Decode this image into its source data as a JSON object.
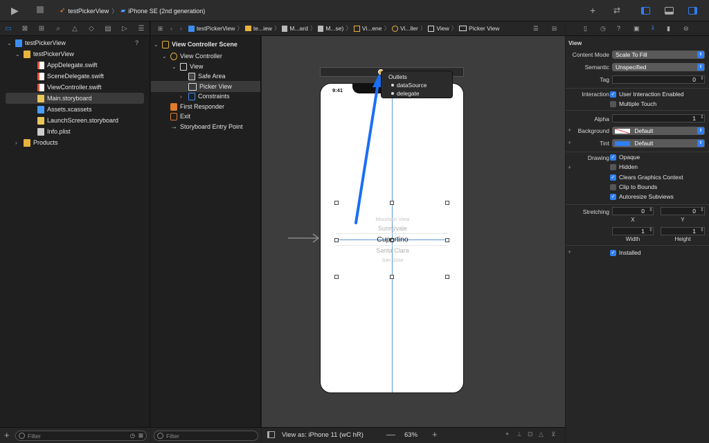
{
  "toolbar": {
    "project_name": "testPickerView",
    "device": "iPhone SE (2nd generation)"
  },
  "navigator": {
    "items": [
      {
        "label": "testPickerView",
        "icon": "project-icon",
        "level": 0,
        "badge": "?"
      },
      {
        "label": "testPickerView",
        "icon": "folder-icon",
        "level": 1
      },
      {
        "label": "AppDelegate.swift",
        "icon": "swift-file-icon",
        "level": 2
      },
      {
        "label": "SceneDelegate.swift",
        "icon": "swift-file-icon",
        "level": 2
      },
      {
        "label": "ViewController.swift",
        "icon": "swift-file-icon",
        "level": 2
      },
      {
        "label": "Main.storyboard",
        "icon": "storyboard-icon",
        "level": 2
      },
      {
        "label": "Assets.xcassets",
        "icon": "assets-icon",
        "level": 2
      },
      {
        "label": "LaunchScreen.storyboard",
        "icon": "storyboard-icon",
        "level": 2
      },
      {
        "label": "Info.plist",
        "icon": "plist-icon",
        "level": 2
      },
      {
        "label": "Products",
        "icon": "folder-icon",
        "level": 1
      }
    ],
    "filter_placeholder": "Filter"
  },
  "jump_bar": {
    "items": [
      "testPickerView",
      "te...iew",
      "M...ard",
      "M...se)",
      "Vi...ene",
      "Vi...ller",
      "View",
      "Picker View"
    ]
  },
  "outline": {
    "items": [
      {
        "label": "View Controller Scene",
        "level": 0
      },
      {
        "label": "View Controller",
        "level": 1
      },
      {
        "label": "View",
        "level": 2
      },
      {
        "label": "Safe Area",
        "level": 3
      },
      {
        "label": "Picker View",
        "level": 3
      },
      {
        "label": "Constraints",
        "level": 3
      },
      {
        "label": "First Responder",
        "level": 1
      },
      {
        "label": "Exit",
        "level": 1
      },
      {
        "label": "Storyboard Entry Point",
        "level": 1
      }
    ],
    "filter_placeholder": "Filter"
  },
  "canvas": {
    "status_time": "9:41",
    "picker_items": [
      "Mountain View",
      "Sunnyvale",
      "Cupertino",
      "Santa Clara",
      "San Jose"
    ],
    "popup": {
      "title": "Outlets",
      "items": [
        "dataSource",
        "delegate"
      ]
    },
    "bottom": {
      "view_as_prefix": "View as: ",
      "view_as_device": "iPhone 11",
      "size_class": "(wC hR)",
      "zoom": "63%"
    }
  },
  "inspector": {
    "section_title": "View",
    "content_mode_label": "Content Mode",
    "content_mode_value": "Scale To Fill",
    "semantic_label": "Semantic",
    "semantic_value": "Unspecified",
    "tag_label": "Tag",
    "tag_value": "0",
    "interaction_label": "Interaction",
    "user_interaction": "User Interaction Enabled",
    "multiple_touch": "Multiple Touch",
    "alpha_label": "Alpha",
    "alpha_value": "1",
    "background_label": "Background",
    "background_value": "Default",
    "tint_label": "Tint",
    "tint_value": "Default",
    "tint_color": "#2f7ff0",
    "drawing_label": "Drawing",
    "opaque": "Opaque",
    "hidden": "Hidden",
    "clears_context": "Clears Graphics Context",
    "clip_bounds": "Clip to Bounds",
    "autoresize": "Autoresize Subviews",
    "stretching_label": "Stretching",
    "stretch_x": "0",
    "stretch_y": "0",
    "x_label": "X",
    "y_label": "Y",
    "stretch_w": "1",
    "stretch_h": "1",
    "width_label": "Width",
    "height_label": "Height",
    "installed": "Installed"
  },
  "colors": {
    "accent": "#2f7ff0",
    "arrow": "#1a6ef5"
  }
}
